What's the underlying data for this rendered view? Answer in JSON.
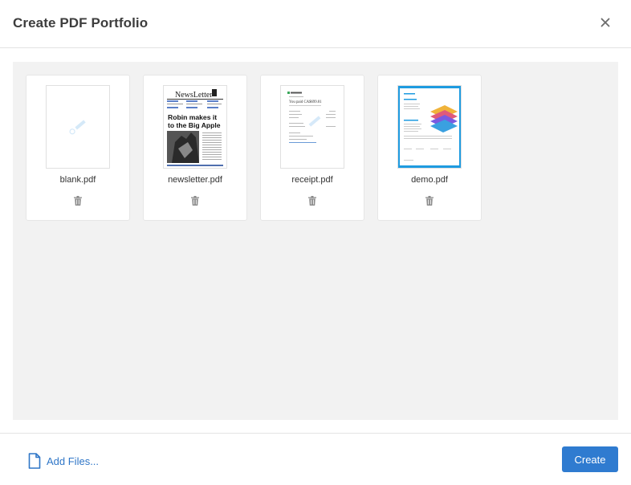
{
  "dialog": {
    "title": "Create PDF Portfolio"
  },
  "files": [
    {
      "name": "blank.pdf",
      "thumbnail": "blank-page-thumbnail"
    },
    {
      "name": "newsletter.pdf",
      "thumbnail": "newsletter-thumbnail"
    },
    {
      "name": "receipt.pdf",
      "thumbnail": "receipt-thumbnail"
    },
    {
      "name": "demo.pdf",
      "thumbnail": "demo-thumbnail"
    }
  ],
  "newsletter_preview": {
    "masthead": "NewsLetter",
    "headline_line1": "Robin makes it",
    "headline_line2": "to the Big Apple"
  },
  "receipt_preview": {
    "amount": "You paid CA$699.81"
  },
  "footer": {
    "add_files_label": "Add Files...",
    "create_label": "Create"
  },
  "colors": {
    "accent": "#2f7bd0",
    "link": "#2f76c7",
    "content_bg": "#f2f2f2"
  },
  "icons": {
    "close": "close-icon",
    "trash": "trash-icon",
    "add_file": "file-icon"
  }
}
